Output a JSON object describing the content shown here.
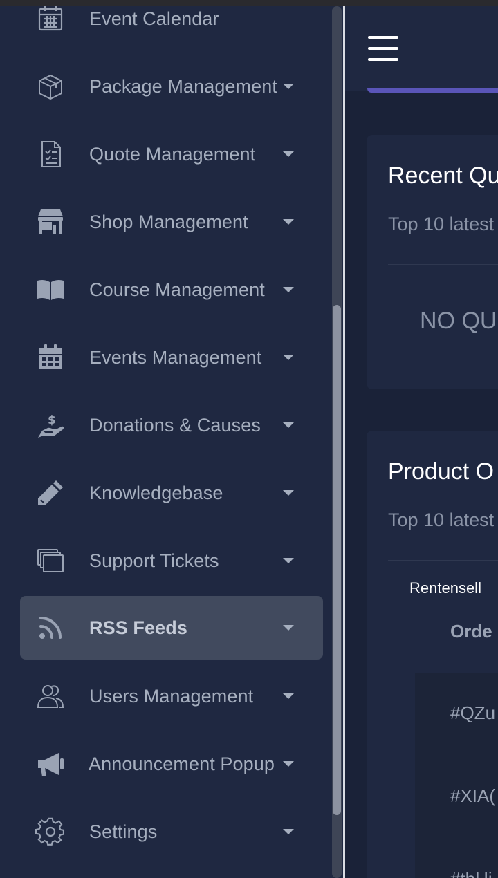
{
  "sidebar": {
    "items": [
      {
        "label": "Event Calendar",
        "icon": "calendar-grid-icon",
        "caret": false
      },
      {
        "label": "Package Management",
        "icon": "package-box-icon",
        "caret": true
      },
      {
        "label": "Quote Management",
        "icon": "quote-document-icon",
        "caret": true
      },
      {
        "label": "Shop Management",
        "icon": "storefront-icon",
        "caret": true
      },
      {
        "label": "Course Management",
        "icon": "open-book-icon",
        "caret": true
      },
      {
        "label": "Events Management",
        "icon": "calendar-icon",
        "caret": true
      },
      {
        "label": "Donations & Causes",
        "icon": "donation-hand-icon",
        "caret": true
      },
      {
        "label": "Knowledgebase",
        "icon": "pencil-icon",
        "caret": true
      },
      {
        "label": "Support Tickets",
        "icon": "tickets-icon",
        "caret": true
      },
      {
        "label": "RSS Feeds",
        "icon": "rss-icon",
        "caret": true,
        "active": true
      },
      {
        "label": "Users Management",
        "icon": "users-icon",
        "caret": true
      },
      {
        "label": "Announcement Popup",
        "icon": "megaphone-icon",
        "caret": true
      },
      {
        "label": "Settings",
        "icon": "gear-icon",
        "caret": true
      }
    ]
  },
  "main": {
    "recent_quotes": {
      "title": "Recent Qu",
      "subtitle": "Top 10 latest",
      "empty_text": "NO QU"
    },
    "product_orders": {
      "title": "Product O",
      "subtitle": "Top 10 latest",
      "brand": "Rentensell",
      "column_header": "Orde",
      "order_ids": [
        "#QZu",
        "#XIA(",
        "#thUi"
      ]
    }
  },
  "colors": {
    "sidebar_bg": "#1f2841",
    "active_item_bg": "#414a5e",
    "accent": "#5a55b8"
  }
}
